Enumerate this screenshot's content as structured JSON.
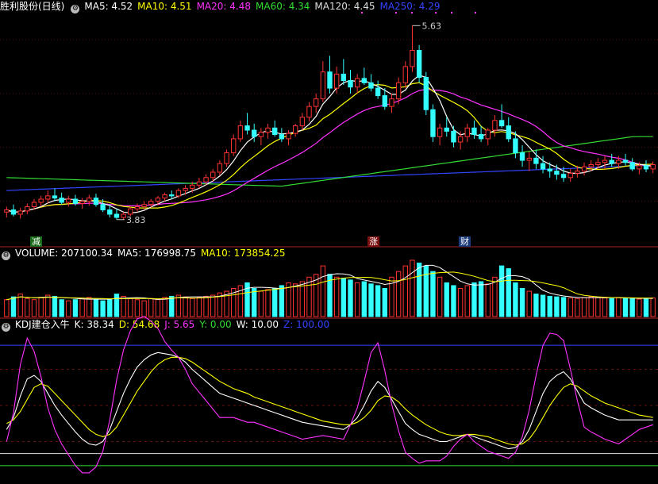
{
  "header_price": {
    "title": "胜利股份(日线)",
    "items": [
      {
        "label": "MA5: 4.52",
        "color": "#ffffff"
      },
      {
        "label": "MA10: 4.51",
        "color": "#ffff00"
      },
      {
        "label": "MA20: 4.48",
        "color": "#ff33ff"
      },
      {
        "label": "MA60: 4.34",
        "color": "#33dd33"
      },
      {
        "label": "MA120: 4.45",
        "color": "#dddddd"
      },
      {
        "label": "MA250: 4.29",
        "color": "#3344ff"
      }
    ]
  },
  "header_volume": {
    "items": [
      {
        "label": "VOLUME: 207100.34",
        "color": "#ffffff"
      },
      {
        "label": "MA5: 176998.75",
        "color": "#ffffff"
      },
      {
        "label": "MA10: 173854.25",
        "color": "#ffff00"
      }
    ]
  },
  "header_kdj": {
    "items": [
      {
        "label": "KDJ建仓入牛",
        "color": "#ffffff"
      },
      {
        "label": "K: 38.34",
        "color": "#ffffff"
      },
      {
        "label": "D: 54.68",
        "color": "#ffff00"
      },
      {
        "label": "J: 5.65",
        "color": "#ff33ff"
      },
      {
        "label": "Y: 0.00",
        "color": "#33dd33"
      },
      {
        "label": "W: 10.00",
        "color": "#ffffff"
      },
      {
        "label": "Z: 100.00",
        "color": "#3344ff"
      }
    ]
  },
  "tags": [
    {
      "text": "减",
      "bg": "#1a6b1a",
      "color": "#ffffff"
    },
    {
      "text": "涨",
      "bg": "#7a1010",
      "color": "#ffffff"
    },
    {
      "text": "财",
      "bg": "#1a3a7a",
      "color": "#ffffff"
    }
  ],
  "chart_data": [
    {
      "type": "candlestick",
      "price_range": [
        3.6,
        5.75
      ],
      "high_label": "5.63",
      "low_label": "3.83",
      "candles_ohlc": [
        [
          3.9,
          3.95,
          3.85,
          3.92
        ],
        [
          3.92,
          3.97,
          3.86,
          3.88
        ],
        [
          3.88,
          3.94,
          3.84,
          3.91
        ],
        [
          3.91,
          3.98,
          3.88,
          3.95
        ],
        [
          3.95,
          4.02,
          3.92,
          3.99
        ],
        [
          3.99,
          4.05,
          3.95,
          4.02
        ],
        [
          4.02,
          4.1,
          3.98,
          4.05
        ],
        [
          4.05,
          4.12,
          4.0,
          4.03
        ],
        [
          4.03,
          4.08,
          3.97,
          3.99
        ],
        [
          3.99,
          4.05,
          3.95,
          4.02
        ],
        [
          4.02,
          4.06,
          3.96,
          3.98
        ],
        [
          3.98,
          4.03,
          3.93,
          4.0
        ],
        [
          4.0,
          4.06,
          3.96,
          4.03
        ],
        [
          4.03,
          4.07,
          3.95,
          3.97
        ],
        [
          3.97,
          4.02,
          3.9,
          3.92
        ],
        [
          3.92,
          3.97,
          3.85,
          3.88
        ],
        [
          3.88,
          3.93,
          3.83,
          3.85
        ],
        [
          3.85,
          3.9,
          3.83,
          3.88
        ],
        [
          3.88,
          3.95,
          3.86,
          3.93
        ],
        [
          3.93,
          3.98,
          3.9,
          3.95
        ],
        [
          3.95,
          4.0,
          3.92,
          3.97
        ],
        [
          3.97,
          4.02,
          3.94,
          4.0
        ],
        [
          4.0,
          4.05,
          3.96,
          4.03
        ],
        [
          4.03,
          4.08,
          4.0,
          4.06
        ],
        [
          4.06,
          4.1,
          4.02,
          4.05
        ],
        [
          4.05,
          4.12,
          4.03,
          4.1
        ],
        [
          4.1,
          4.15,
          4.06,
          4.12
        ],
        [
          4.12,
          4.18,
          4.08,
          4.15
        ],
        [
          4.15,
          4.22,
          4.12,
          4.18
        ],
        [
          4.18,
          4.25,
          4.15,
          4.22
        ],
        [
          4.22,
          4.3,
          4.18,
          4.27
        ],
        [
          4.27,
          4.38,
          4.24,
          4.35
        ],
        [
          4.35,
          4.48,
          4.32,
          4.45
        ],
        [
          4.45,
          4.62,
          4.42,
          4.58
        ],
        [
          4.58,
          4.75,
          4.55,
          4.7
        ],
        [
          4.7,
          4.82,
          4.62,
          4.66
        ],
        [
          4.66,
          4.72,
          4.55,
          4.6
        ],
        [
          4.6,
          4.68,
          4.52,
          4.64
        ],
        [
          4.64,
          4.72,
          4.58,
          4.68
        ],
        [
          4.68,
          4.75,
          4.6,
          4.62
        ],
        [
          4.62,
          4.68,
          4.55,
          4.58
        ],
        [
          4.58,
          4.66,
          4.52,
          4.63
        ],
        [
          4.63,
          4.72,
          4.6,
          4.7
        ],
        [
          4.7,
          4.82,
          4.66,
          4.78
        ],
        [
          4.78,
          4.92,
          4.74,
          4.88
        ],
        [
          4.88,
          5.0,
          4.82,
          4.95
        ],
        [
          4.95,
          5.3,
          4.92,
          5.2
        ],
        [
          5.2,
          5.35,
          5.0,
          5.05
        ],
        [
          5.05,
          5.25,
          5.0,
          5.18
        ],
        [
          5.18,
          5.32,
          5.08,
          5.12
        ],
        [
          5.12,
          5.22,
          5.0,
          5.06
        ],
        [
          5.06,
          5.18,
          5.0,
          5.14
        ],
        [
          5.14,
          5.24,
          5.08,
          5.1
        ],
        [
          5.1,
          5.18,
          5.02,
          5.05
        ],
        [
          5.05,
          5.12,
          4.95,
          4.98
        ],
        [
          4.98,
          5.05,
          4.85,
          4.88
        ],
        [
          4.88,
          5.0,
          4.82,
          4.95
        ],
        [
          4.95,
          5.15,
          4.9,
          5.1
        ],
        [
          5.1,
          5.3,
          5.05,
          5.25
        ],
        [
          5.25,
          5.63,
          5.2,
          5.4
        ],
        [
          5.4,
          5.45,
          5.1,
          5.15
        ],
        [
          5.15,
          5.2,
          4.8,
          4.85
        ],
        [
          4.85,
          4.9,
          4.55,
          4.6
        ],
        [
          4.6,
          4.72,
          4.52,
          4.68
        ],
        [
          4.68,
          4.78,
          4.6,
          4.65
        ],
        [
          4.65,
          4.7,
          4.5,
          4.55
        ],
        [
          4.55,
          4.65,
          4.48,
          4.6
        ],
        [
          4.6,
          4.72,
          4.55,
          4.68
        ],
        [
          4.68,
          4.75,
          4.58,
          4.62
        ],
        [
          4.62,
          4.7,
          4.55,
          4.58
        ],
        [
          4.58,
          4.68,
          4.52,
          4.66
        ],
        [
          4.66,
          4.8,
          4.6,
          4.75
        ],
        [
          4.75,
          4.9,
          4.68,
          4.7
        ],
        [
          4.7,
          4.78,
          4.55,
          4.58
        ],
        [
          4.58,
          4.65,
          4.4,
          4.45
        ],
        [
          4.45,
          4.52,
          4.32,
          4.38
        ],
        [
          4.38,
          4.46,
          4.28,
          4.4
        ],
        [
          4.4,
          4.48,
          4.3,
          4.35
        ],
        [
          4.35,
          4.42,
          4.26,
          4.3
        ],
        [
          4.3,
          4.36,
          4.22,
          4.28
        ],
        [
          4.28,
          4.34,
          4.2,
          4.25
        ],
        [
          4.25,
          4.32,
          4.18,
          4.22
        ],
        [
          4.22,
          4.3,
          4.18,
          4.26
        ],
        [
          4.26,
          4.33,
          4.22,
          4.28
        ],
        [
          4.28,
          4.36,
          4.24,
          4.32
        ],
        [
          4.32,
          4.38,
          4.28,
          4.34
        ],
        [
          4.34,
          4.4,
          4.3,
          4.36
        ],
        [
          4.36,
          4.42,
          4.3,
          4.38
        ],
        [
          4.38,
          4.44,
          4.32,
          4.35
        ],
        [
          4.35,
          4.42,
          4.3,
          4.38
        ],
        [
          4.38,
          4.44,
          4.33,
          4.36
        ],
        [
          4.36,
          4.4,
          4.28,
          4.3
        ],
        [
          4.3,
          4.36,
          4.25,
          4.33
        ],
        [
          4.33,
          4.38,
          4.27,
          4.3
        ],
        [
          4.3,
          4.37,
          4.26,
          4.34
        ]
      ]
    },
    {
      "type": "bar",
      "values": [
        0.3,
        0.35,
        0.4,
        0.32,
        0.3,
        0.34,
        0.38,
        0.36,
        0.3,
        0.28,
        0.3,
        0.32,
        0.34,
        0.3,
        0.28,
        0.3,
        0.4,
        0.36,
        0.32,
        0.3,
        0.28,
        0.32,
        0.3,
        0.34,
        0.36,
        0.38,
        0.35,
        0.32,
        0.34,
        0.36,
        0.38,
        0.42,
        0.45,
        0.5,
        0.55,
        0.6,
        0.5,
        0.45,
        0.48,
        0.5,
        0.55,
        0.6,
        0.58,
        0.62,
        0.7,
        0.75,
        0.9,
        0.75,
        0.7,
        0.68,
        0.65,
        0.6,
        0.62,
        0.58,
        0.55,
        0.5,
        0.7,
        0.8,
        0.9,
        1.0,
        0.95,
        0.9,
        0.8,
        0.7,
        0.6,
        0.55,
        0.5,
        0.55,
        0.6,
        0.62,
        0.58,
        0.7,
        0.9,
        0.85,
        0.6,
        0.5,
        0.45,
        0.4,
        0.38,
        0.36,
        0.35,
        0.34,
        0.33,
        0.32,
        0.34,
        0.35,
        0.34,
        0.33,
        0.32,
        0.34,
        0.33,
        0.32,
        0.31,
        0.32,
        0.33
      ]
    },
    {
      "type": "line",
      "ylim": [
        -10,
        110
      ],
      "series": [
        {
          "name": "K",
          "values": [
            30,
            40,
            58,
            72,
            75,
            70,
            60,
            50,
            42,
            35,
            28,
            22,
            18,
            17,
            20,
            30,
            45,
            60,
            72,
            82,
            88,
            92,
            94,
            93,
            92,
            90,
            86,
            80,
            75,
            70,
            65,
            60,
            58,
            56,
            54,
            52,
            50,
            48,
            46,
            44,
            42,
            40,
            38,
            36,
            35,
            34,
            33,
            32,
            31,
            30,
            34,
            40,
            50,
            62,
            70,
            65,
            55,
            45,
            35,
            30,
            26,
            24,
            22,
            20,
            20,
            22,
            24,
            26,
            24,
            22,
            20,
            18,
            16,
            14,
            15,
            20,
            30,
            45,
            60,
            70,
            75,
            78,
            72,
            62,
            52,
            48,
            45,
            42,
            40,
            38,
            38,
            38,
            38,
            38,
            38
          ]
        },
        {
          "name": "D",
          "values": [
            35,
            38,
            45,
            55,
            65,
            68,
            66,
            60,
            54,
            48,
            42,
            36,
            30,
            26,
            24,
            26,
            32,
            42,
            52,
            62,
            70,
            78,
            84,
            88,
            90,
            90,
            89,
            86,
            82,
            78,
            74,
            70,
            67,
            64,
            62,
            60,
            57,
            55,
            53,
            51,
            49,
            47,
            45,
            43,
            41,
            39,
            37,
            36,
            35,
            34,
            34,
            36,
            40,
            46,
            54,
            58,
            57,
            53,
            47,
            42,
            38,
            34,
            31,
            28,
            26,
            25,
            25,
            26,
            26,
            25,
            24,
            22,
            20,
            18,
            17,
            18,
            22,
            30,
            40,
            50,
            58,
            65,
            68,
            66,
            62,
            58,
            55,
            52,
            50,
            48,
            46,
            44,
            42,
            41,
            40
          ]
        },
        {
          "name": "J",
          "values": [
            20,
            44,
            84,
            106,
            95,
            74,
            48,
            30,
            18,
            9,
            0,
            -6,
            -6,
            -1,
            12,
            38,
            71,
            96,
            112,
            122,
            124,
            120,
            114,
            103,
            96,
            90,
            80,
            68,
            61,
            54,
            47,
            40,
            40,
            40,
            38,
            36,
            36,
            34,
            32,
            30,
            28,
            26,
            24,
            22,
            23,
            24,
            25,
            24,
            23,
            22,
            34,
            48,
            70,
            94,
            102,
            79,
            51,
            29,
            11,
            6,
            2,
            4,
            4,
            4,
            8,
            16,
            22,
            26,
            20,
            16,
            12,
            10,
            8,
            6,
            11,
            24,
            46,
            75,
            100,
            110,
            109,
            104,
            80,
            54,
            32,
            28,
            25,
            22,
            20,
            18,
            22,
            26,
            30,
            32,
            34
          ]
        }
      ]
    }
  ]
}
